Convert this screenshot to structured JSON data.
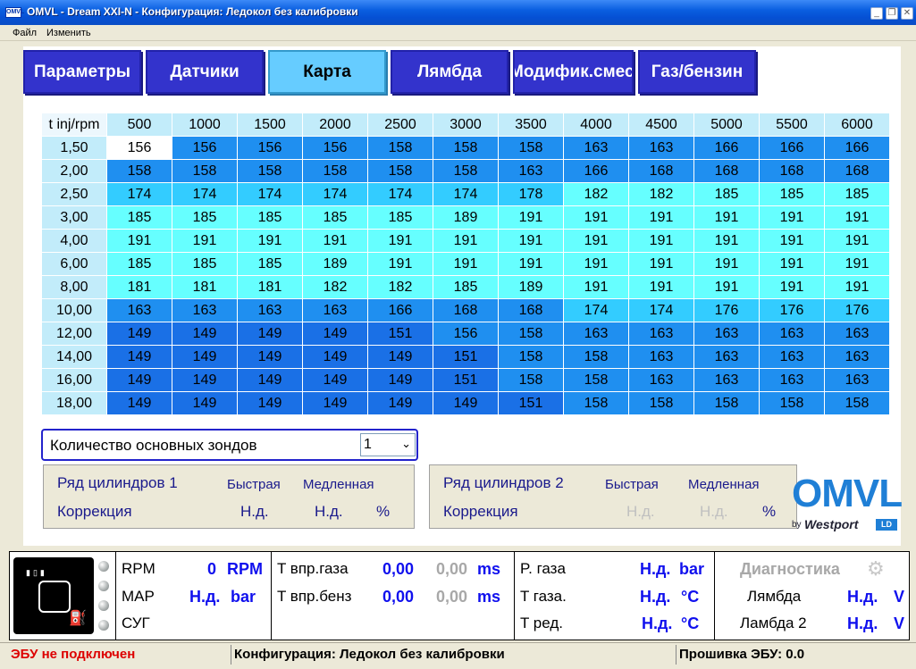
{
  "window": {
    "title": "OMVL - Dream XXI-N - Конфигурация: Ледокол без калибровки",
    "icon_label": "OMVL"
  },
  "menu": {
    "file": "Файл",
    "edit": "Изменить"
  },
  "tabs": [
    {
      "label": "Параметры",
      "active": false
    },
    {
      "label": "Датчики",
      "active": false
    },
    {
      "label": "Карта",
      "active": true
    },
    {
      "label": "Лямбда",
      "active": false
    },
    {
      "label": "Модифик.смеси",
      "active": false
    },
    {
      "label": "Газ/бензин",
      "active": false
    }
  ],
  "map": {
    "corner": "t inj/rpm",
    "rpm": [
      "500",
      "1000",
      "1500",
      "2000",
      "2500",
      "3000",
      "3500",
      "4000",
      "4500",
      "5000",
      "5500",
      "6000"
    ],
    "rows": [
      {
        "t": "1,50",
        "v": [
          156,
          156,
          156,
          156,
          158,
          158,
          158,
          163,
          163,
          166,
          166,
          166
        ]
      },
      {
        "t": "2,00",
        "v": [
          158,
          158,
          158,
          158,
          158,
          158,
          163,
          166,
          168,
          168,
          168,
          168
        ]
      },
      {
        "t": "2,50",
        "v": [
          174,
          174,
          174,
          174,
          174,
          174,
          178,
          182,
          182,
          185,
          185,
          185
        ]
      },
      {
        "t": "3,00",
        "v": [
          185,
          185,
          185,
          185,
          185,
          189,
          191,
          191,
          191,
          191,
          191,
          191
        ]
      },
      {
        "t": "4,00",
        "v": [
          191,
          191,
          191,
          191,
          191,
          191,
          191,
          191,
          191,
          191,
          191,
          191
        ]
      },
      {
        "t": "6,00",
        "v": [
          185,
          185,
          185,
          189,
          191,
          191,
          191,
          191,
          191,
          191,
          191,
          191
        ]
      },
      {
        "t": "8,00",
        "v": [
          181,
          181,
          181,
          182,
          182,
          185,
          189,
          191,
          191,
          191,
          191,
          191
        ]
      },
      {
        "t": "10,00",
        "v": [
          163,
          163,
          163,
          163,
          166,
          168,
          168,
          174,
          174,
          176,
          176,
          176
        ]
      },
      {
        "t": "12,00",
        "v": [
          149,
          149,
          149,
          149,
          151,
          156,
          158,
          163,
          163,
          163,
          163,
          163
        ]
      },
      {
        "t": "14,00",
        "v": [
          149,
          149,
          149,
          149,
          149,
          151,
          158,
          158,
          163,
          163,
          163,
          163
        ]
      },
      {
        "t": "16,00",
        "v": [
          149,
          149,
          149,
          149,
          149,
          151,
          158,
          158,
          163,
          163,
          163,
          163
        ]
      },
      {
        "t": "18,00",
        "v": [
          149,
          149,
          149,
          149,
          149,
          149,
          151,
          158,
          158,
          158,
          158,
          158
        ]
      }
    ],
    "selected_cell": [
      0,
      0
    ],
    "colors": {
      "high": "#66ffff",
      "mid": "#33ccff",
      "low": "#1f8ff0",
      "lowest": "#1a70e6"
    }
  },
  "probes": {
    "label": "Количество основных зондов",
    "value": "1"
  },
  "bank1": {
    "title": "Ряд цилиндров 1",
    "fast": "Быстрая",
    "slow": "Медленная",
    "corr": "Коррекция",
    "fast_val": "Н.д.",
    "slow_val": "Н.д.",
    "unit": "%"
  },
  "bank2": {
    "title": "Ряд цилиндров 2",
    "fast": "Быстрая",
    "slow": "Медленная",
    "corr": "Коррекция",
    "fast_val": "Н.д.",
    "slow_val": "Н.д.",
    "unit": "%"
  },
  "logo": {
    "brand": "OMVL",
    "by": "by",
    "partner": "Westport",
    "tag": "LD"
  },
  "gauges": {
    "rpm": {
      "label": "RPM",
      "value": "0",
      "unit": "RPM"
    },
    "map": {
      "label": "MAP",
      "value": "Н.д.",
      "unit": "bar"
    },
    "sug": {
      "label": "СУГ"
    },
    "t_gas": {
      "label": "T впр.газа",
      "value": "0,00",
      "value2": "0,00",
      "unit": "ms"
    },
    "t_pet": {
      "label": "T впр.бенз",
      "value": "0,00",
      "value2": "0,00",
      "unit": "ms"
    },
    "p_gas": {
      "label": "P. газа",
      "value": "Н.д.",
      "unit": "bar"
    },
    "temp_gas": {
      "label": "T газа.",
      "value": "Н.д.",
      "unit": "°C"
    },
    "temp_red": {
      "label": "T ред.",
      "value": "Н.д.",
      "unit": "°C"
    },
    "diag": {
      "label": "Диагностика"
    },
    "lambda1": {
      "label": "Лямбда",
      "value": "Н.д.",
      "unit": "V"
    },
    "lambda2": {
      "label": "Ламбда 2",
      "value": "Н.д.",
      "unit": "V"
    }
  },
  "status": {
    "ecu": "ЭБУ не подключен",
    "config": "Конфигурация: Ледокол без калибровки",
    "firmware": "Прошивка ЭБУ: 0.0"
  }
}
